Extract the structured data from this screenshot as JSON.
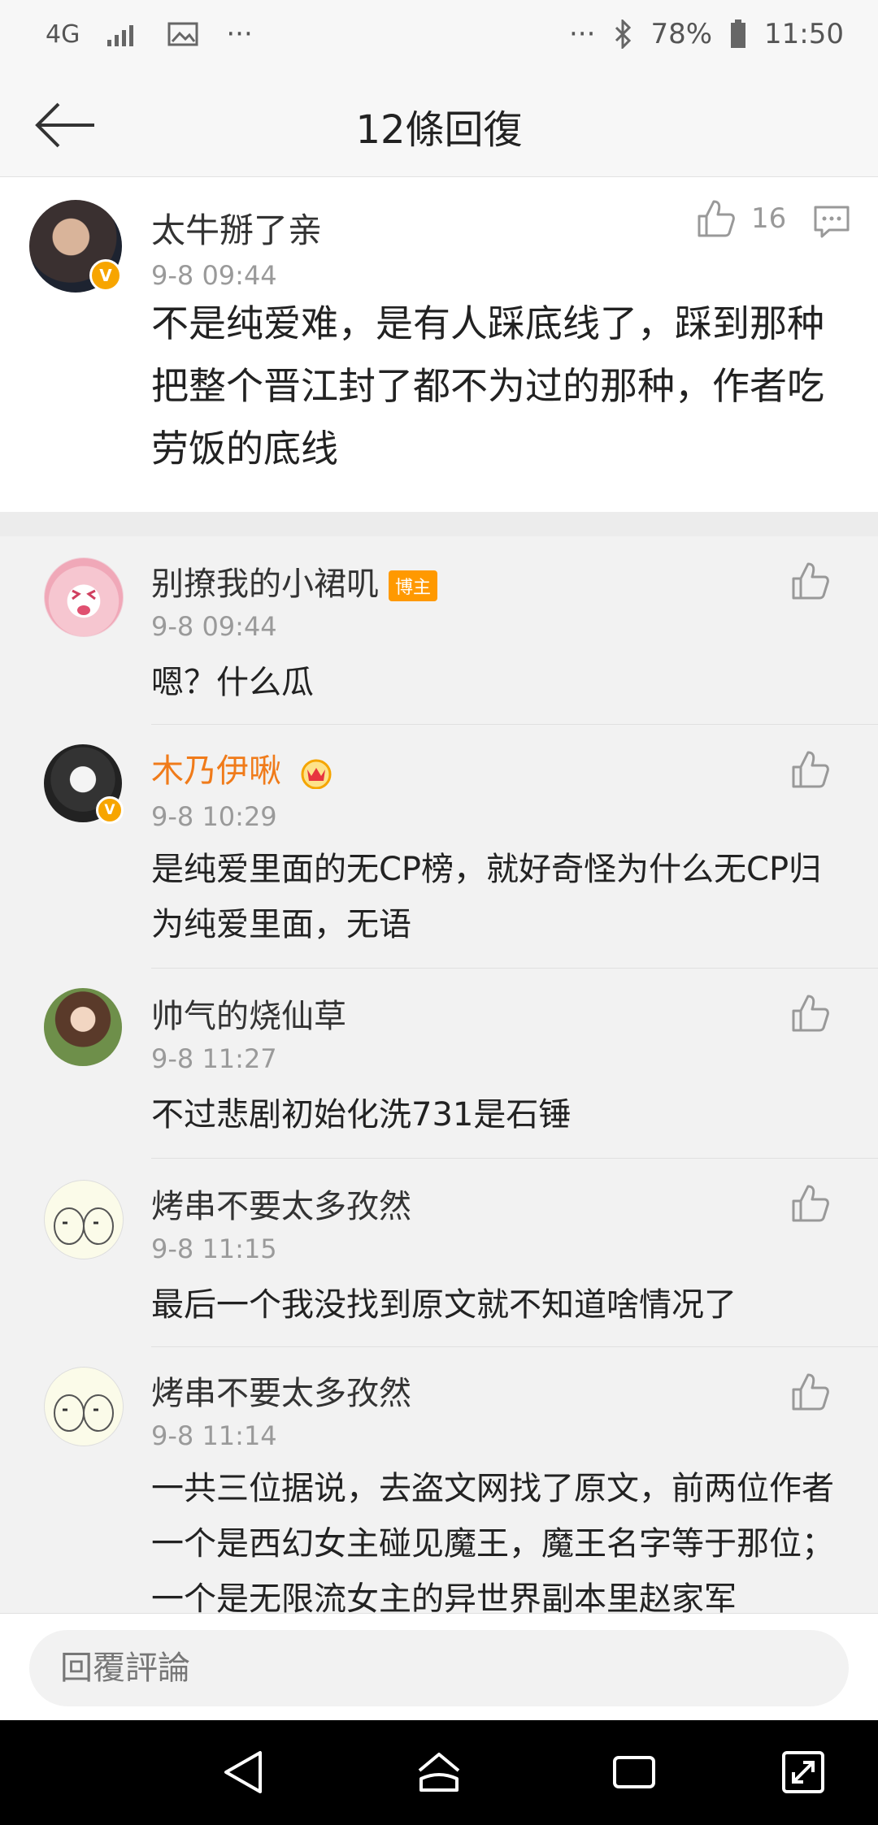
{
  "status_bar": {
    "network": "4G",
    "dots_left": "···",
    "dots_right": "···",
    "battery": "78%",
    "time": "11:50"
  },
  "header": {
    "title": "12條回復"
  },
  "main_comment": {
    "username": "太牛掰了亲",
    "time": "9-8 09:44",
    "likes": "16",
    "text": "不是纯爱难，是有人踩底线了，踩到那种把整个晋江封了都不为过的那种，作者吃劳饭的底线"
  },
  "replies": [
    {
      "username": "别撩我的小裙叽",
      "tag": "博主",
      "time": "9-8 09:44",
      "text": "嗯？什么瓜"
    },
    {
      "username": "木乃伊啾",
      "time": "9-8 10:29",
      "text": "是纯爱里面的无CP榜，就好奇怪为什么无CP归为纯爱里面，无语"
    },
    {
      "username": "帅气的烧仙草",
      "time": "9-8 11:27",
      "text": "不过悲剧初始化洗731是石锤"
    },
    {
      "username": "烤串不要太多孜然",
      "time": "9-8 11:15",
      "text": "最后一个我没找到原文就不知道啥情况了"
    },
    {
      "username": "烤串不要太多孜然",
      "time": "9-8 11:14",
      "text": "一共三位据说，去盗文网找了原文，前两位作者一个是西幻女主碰见魔王，魔王名字等于那位；一个是无限流女主的异世界副本里赵家军"
    }
  ],
  "bottom": {
    "placeholder": "回覆評論"
  },
  "colors": {
    "highlight_name": "#f07b1a",
    "blogger_tag": "#ff9900",
    "verify": "#f7a500"
  }
}
